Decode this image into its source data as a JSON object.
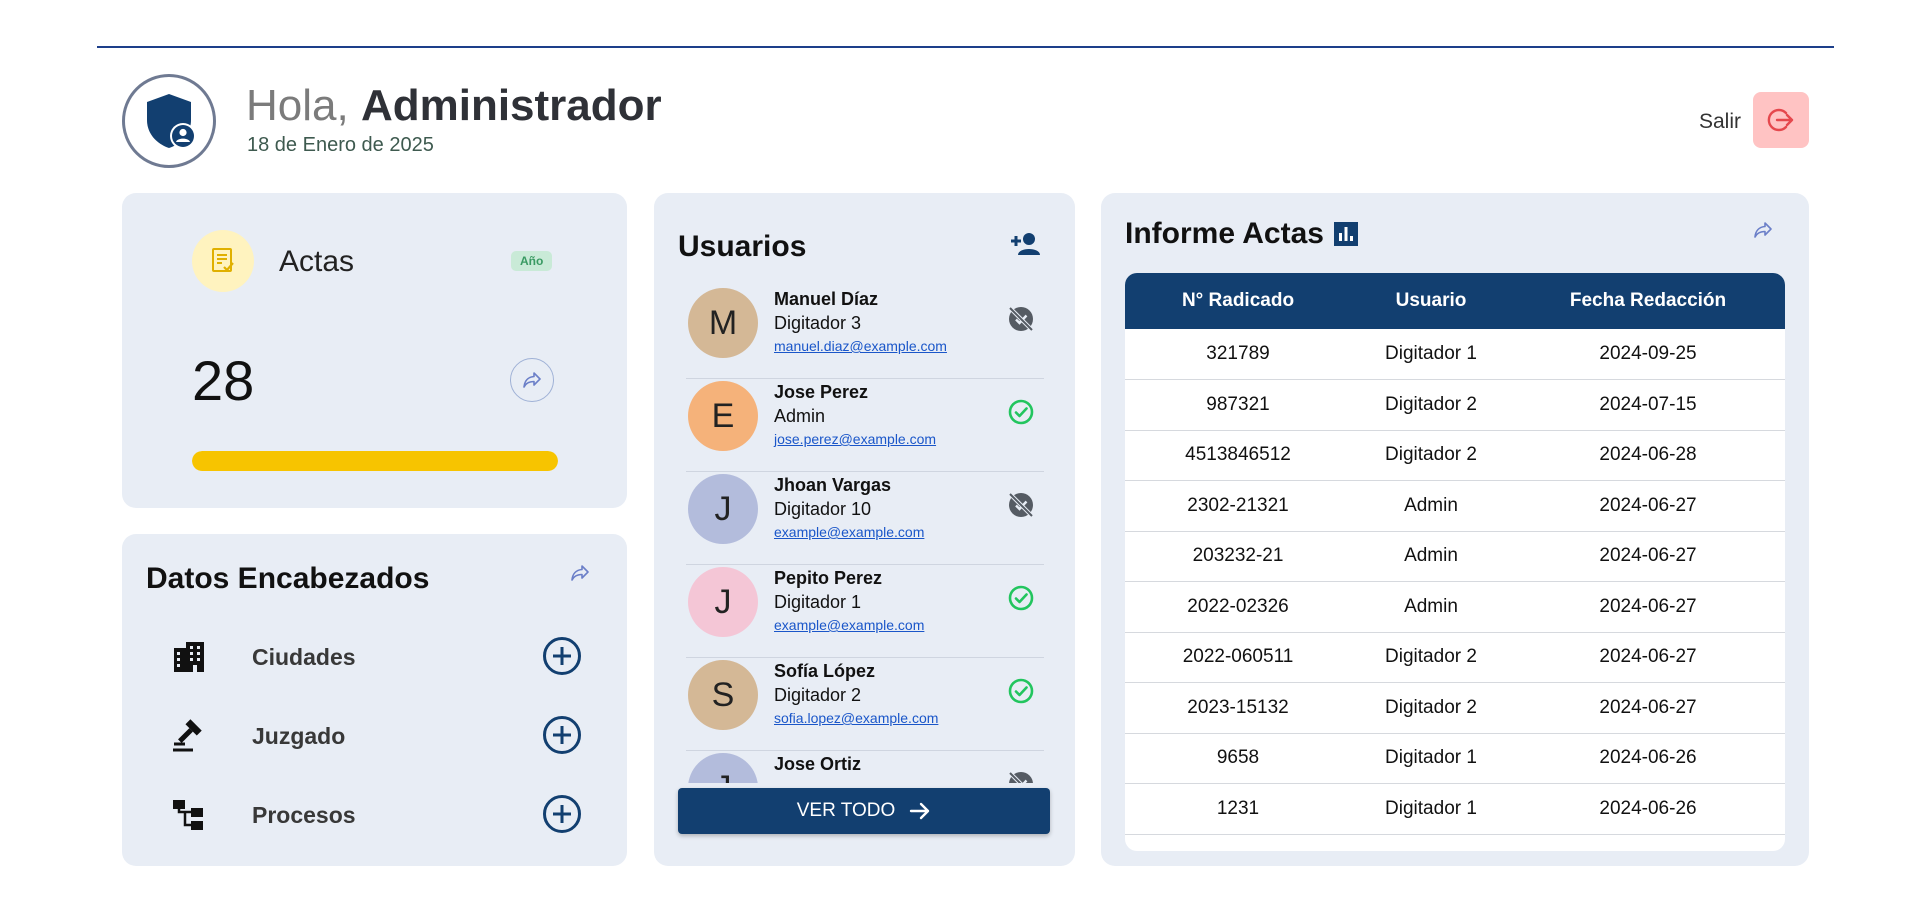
{
  "header": {
    "greeting_prefix": "Hola,",
    "user_name": "Administrador",
    "date": "18 de Enero de 2025",
    "logout_label": "Salir"
  },
  "actas": {
    "title": "Actas",
    "badge": "Año",
    "count": "28",
    "progress_percent": 100,
    "accent": "#f7c400"
  },
  "datos": {
    "title": "Datos Encabezados",
    "items": [
      {
        "label": "Ciudades",
        "icon": "building-icon"
      },
      {
        "label": "Juzgado",
        "icon": "gavel-icon"
      },
      {
        "label": "Procesos",
        "icon": "process-tree-icon"
      }
    ]
  },
  "usuarios": {
    "title": "Usuarios",
    "button_label": "VER TODO",
    "items": [
      {
        "initial": "M",
        "name": "Manuel Díaz",
        "role": "Digitador 3",
        "email": "manuel.diaz@example.com",
        "active": false,
        "color": "#d4b896"
      },
      {
        "initial": "E",
        "name": "Jose Perez",
        "role": "Admin",
        "email": "jose.perez@example.com",
        "active": true,
        "color": "#f5b27a"
      },
      {
        "initial": "J",
        "name": "Jhoan Vargas",
        "role": "Digitador 10",
        "email": "example@example.com",
        "active": false,
        "color": "#b3bcdc"
      },
      {
        "initial": "J",
        "name": "Pepito Perez",
        "role": "Digitador 1",
        "email": "example@example.com",
        "active": true,
        "color": "#f4c6d6"
      },
      {
        "initial": "S",
        "name": "Sofía López",
        "role": "Digitador 2",
        "email": "sofia.lopez@example.com",
        "active": true,
        "color": "#d4b896"
      },
      {
        "initial": "J",
        "name": "Jose Ortiz",
        "role": "",
        "email": "",
        "active": false,
        "color": "#b3bcdc"
      }
    ]
  },
  "informe": {
    "title": "Informe Actas",
    "columns": [
      "N° Radicado",
      "Usuario",
      "Fecha Redacción"
    ],
    "rows": [
      [
        "321789",
        "Digitador 1",
        "2024-09-25"
      ],
      [
        "987321",
        "Digitador 2",
        "2024-07-15"
      ],
      [
        "4513846512",
        "Digitador 2",
        "2024-06-28"
      ],
      [
        "2302-21321",
        "Admin",
        "2024-06-27"
      ],
      [
        "203232-21",
        "Admin",
        "2024-06-27"
      ],
      [
        "2022-02326",
        "Admin",
        "2024-06-27"
      ],
      [
        "2022-060511",
        "Digitador 2",
        "2024-06-27"
      ],
      [
        "2023-15132",
        "Digitador 2",
        "2024-06-27"
      ],
      [
        "9658",
        "Digitador 1",
        "2024-06-26"
      ],
      [
        "1231",
        "Digitador 1",
        "2024-06-26"
      ]
    ]
  },
  "colors": {
    "primary": "#123f70",
    "card_bg": "#e8edf5",
    "active": "#22c55e",
    "inactive": "#555b63",
    "logout_bg": "#ffc3c3"
  }
}
